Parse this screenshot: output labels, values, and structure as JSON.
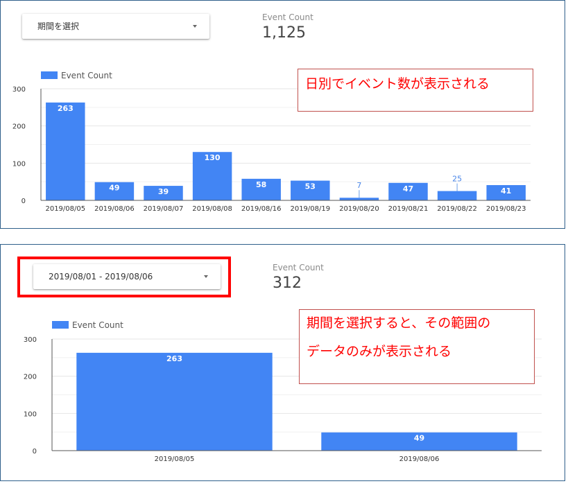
{
  "panel1": {
    "dropdown_label": "期間を選択",
    "scorecard": {
      "label": "Event Count",
      "value": "1,125"
    },
    "callout": "日別でイベント数が表示される"
  },
  "panel2": {
    "dropdown_label": "2019/08/01 - 2019/08/06",
    "scorecard": {
      "label": "Event Count",
      "value": "312"
    },
    "callout_lines": [
      "期間を選択すると、その範囲の",
      "データのみが表示される"
    ]
  },
  "colors": {
    "bar": "#4285f4",
    "grid": "#e6e6e6",
    "axis": "#555555",
    "callout_text": "#ff0000",
    "highlight": "#ff0000"
  },
  "chart_data": [
    {
      "type": "bar",
      "categories": [
        "2019/08/05",
        "2019/08/06",
        "2019/08/07",
        "2019/08/08",
        "2019/08/16",
        "2019/08/19",
        "2019/08/20",
        "2019/08/21",
        "2019/08/22",
        "2019/08/23"
      ],
      "series": [
        {
          "name": "Event Count",
          "values": [
            263,
            49,
            39,
            130,
            58,
            53,
            7,
            47,
            25,
            41
          ]
        }
      ],
      "yticks": [
        0,
        100,
        200,
        300
      ],
      "ylim": [
        0,
        300
      ],
      "legend": "top-left",
      "grid": true
    },
    {
      "type": "bar",
      "categories": [
        "2019/08/05",
        "2019/08/06"
      ],
      "series": [
        {
          "name": "Event Count",
          "values": [
            263,
            49
          ]
        }
      ],
      "yticks": [
        0,
        100,
        200,
        300
      ],
      "ylim": [
        0,
        300
      ],
      "legend": "top-left",
      "grid": true
    }
  ]
}
